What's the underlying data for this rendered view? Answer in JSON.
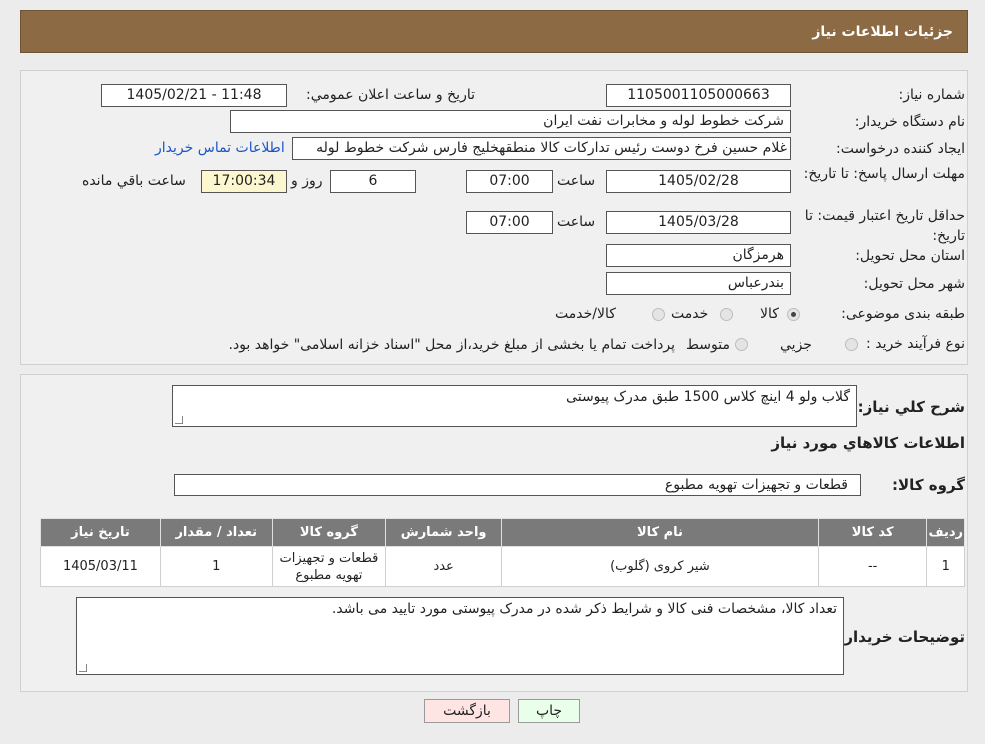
{
  "header": {
    "title": "جزئیات اطلاعات نیاز"
  },
  "form": {
    "need_number": {
      "label": "شماره نیاز:",
      "value": "1105001105000663"
    },
    "announce_datetime": {
      "label": "تاریخ و ساعت اعلان عمومي:",
      "value": "1405/02/21 - 11:48"
    },
    "buyer_org": {
      "label": "نام دستگاه خريدار:",
      "value": "شرکت خطوط لوله و مخابرات نفت ايران"
    },
    "requester": {
      "label": "ايجاد کننده درخواست:",
      "value": "غلام حسين فرخ دوست رئيس تداركات كالا منطقهخليج فارس شرکت خطوط لوله",
      "contact_link": "اطلاعات تماس خريدار"
    },
    "reply_deadline": {
      "label": "مهلت ارسال پاسخ: تا تاریخ:",
      "date": "1405/02/28",
      "time_label": "ساعت",
      "time": "07:00",
      "days": "6",
      "days_label": "روز و",
      "remaining": "17:00:34",
      "remaining_label": "ساعت باقي مانده"
    },
    "price_validity": {
      "label": "حداقل تاریخ اعتبار قیمت: تا تاریخ:",
      "date": "1405/03/28",
      "time_label": "ساعت",
      "time": "07:00"
    },
    "province": {
      "label": "استان محل تحویل:",
      "value": "هرمزگان"
    },
    "city": {
      "label": "شهر محل تحویل:",
      "value": "بندرعباس"
    },
    "category": {
      "label": "طبقه بندی موضوعی:",
      "options": [
        "کالا",
        "خدمت",
        "کالا/خدمت"
      ],
      "selected": "کالا"
    },
    "process_type": {
      "label": "نوع فرآیند خرید :",
      "options": [
        "جزيي",
        "متوسط"
      ],
      "note": "پرداخت تمام یا بخشی از مبلغ خرید،از محل \"اسناد خزانه اسلامی\" خواهد بود."
    }
  },
  "details": {
    "summary_label": "شرح کلي نياز:",
    "summary_value": "گلاب ولو 4 اینچ کلاس 1500 طبق مدرک پیوستی",
    "items_title": "اطلاعات کالاهاي مورد نياز",
    "group_label": "گروه کالا:",
    "group_value": "قطعات و تجهیزات تهویه مطبوع",
    "table": {
      "headers": [
        "رديف",
        "کد کالا",
        "نام کالا",
        "واحد شمارش",
        "گروه کالا",
        "تعداد / مقدار",
        "تاریخ نیاز"
      ],
      "rows": [
        [
          "1",
          "--",
          "شیر کروی (گلوب)",
          "عدد",
          "قطعات و تجهیزات تهویه مطبوع",
          "1",
          "1405/03/11"
        ]
      ]
    },
    "buyer_notes_label": "توضیحات خریدار:",
    "buyer_notes_value": "تعداد کالا، مشخصات فنی کالا و شرایط ذکر شده در مدرک پیوستی مورد تایید می باشد."
  },
  "buttons": {
    "print": "چاپ",
    "back": "بازگشت"
  },
  "colors": {
    "header": "#8b6a44",
    "table_header": "#7a7a7a",
    "print_btn": "#eaffea",
    "back_btn": "#ffe4e4",
    "remaining_bg": "#fdf7d0"
  }
}
